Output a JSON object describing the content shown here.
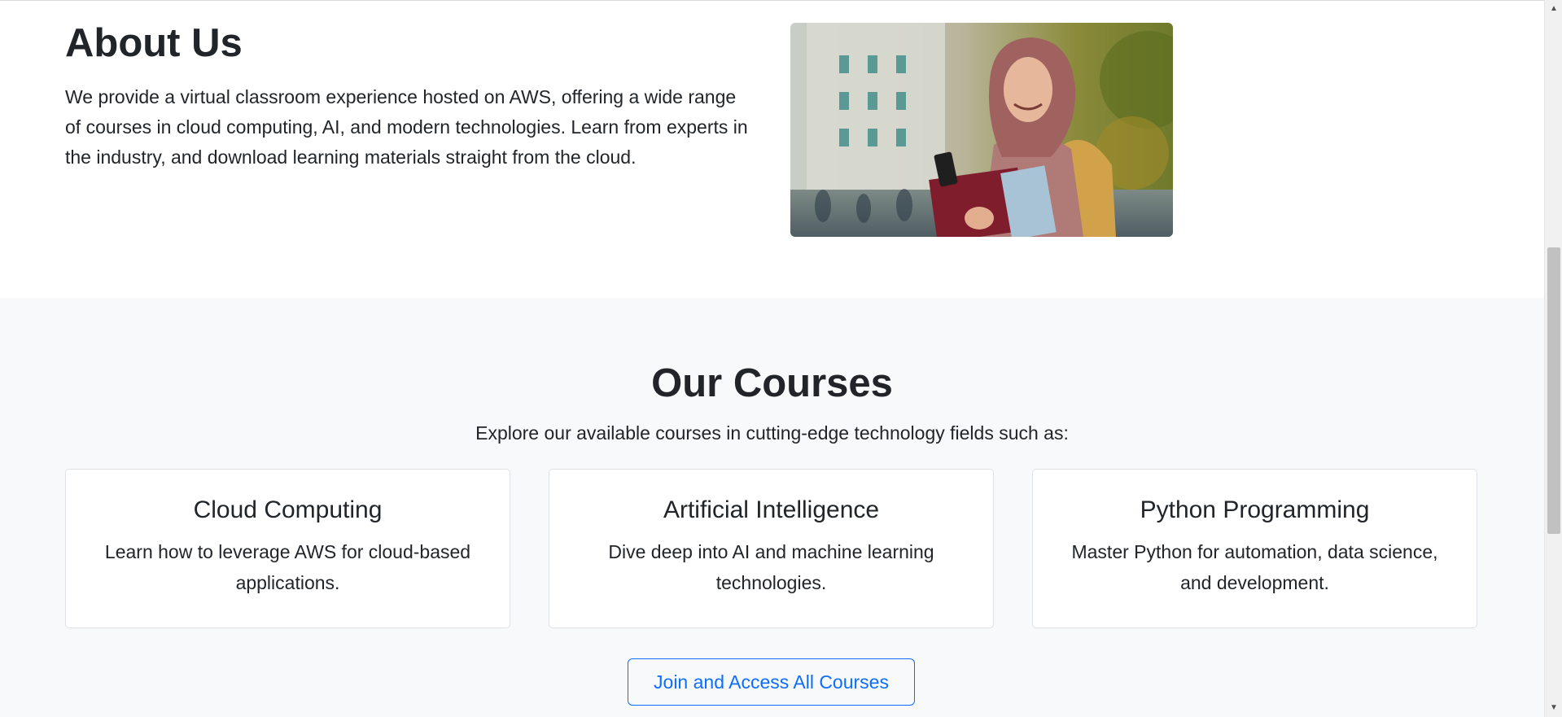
{
  "about": {
    "title": "About Us",
    "text": "We provide a virtual classroom experience hosted on AWS, offering a wide range of courses in cloud computing, AI, and modern technologies. Learn from experts in the industry, and download learning materials straight from the cloud.",
    "photo_alt": "Smiling student with backpack holding books"
  },
  "courses": {
    "title": "Our Courses",
    "subtitle": "Explore our available courses in cutting-edge technology fields such as:",
    "cards": [
      {
        "title": "Cloud Computing",
        "text": "Learn how to leverage AWS for cloud-based applications."
      },
      {
        "title": "Artificial Intelligence",
        "text": "Dive deep into AI and machine learning technologies."
      },
      {
        "title": "Python Programming",
        "text": "Master Python for automation, data science, and development."
      }
    ],
    "join_button": "Join and Access All Courses"
  },
  "scrollbar": {
    "up_icon": "▲",
    "down_icon": "▼"
  },
  "colors": {
    "primary": "#0d6efd",
    "text": "#212529",
    "section_bg": "#f8f9fa"
  }
}
